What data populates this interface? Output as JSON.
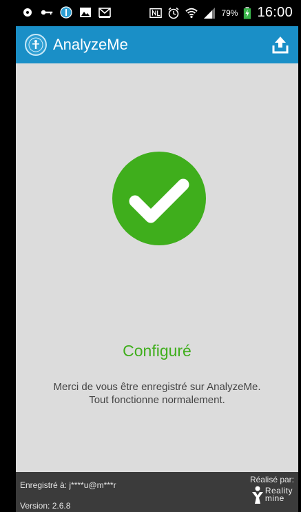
{
  "statusbar": {
    "battery": "79%",
    "time": "16:00",
    "icons": [
      "notification-dot-icon",
      "vpn-key-icon",
      "compass-icon",
      "image-icon",
      "email-icon",
      "nfc-icon",
      "alarm-icon",
      "wifi-icon",
      "signal-icon",
      "battery-charging-icon"
    ]
  },
  "appbar": {
    "title": "AnalyzeMe",
    "accent": "#1a8fc7"
  },
  "main": {
    "status_title": "Configuré",
    "message_line1": "Merci de vous être enregistré sur AnalyzeMe.",
    "message_line2": "Tout fonctionne normalement.",
    "check_color": "#3fae1c"
  },
  "footer": {
    "registered": "Enregistré à: j****u@m***r",
    "version": "Version: 2.6.8",
    "made_by": "Réalisé par:",
    "brand_line1": "Reality",
    "brand_line2": "mine"
  }
}
